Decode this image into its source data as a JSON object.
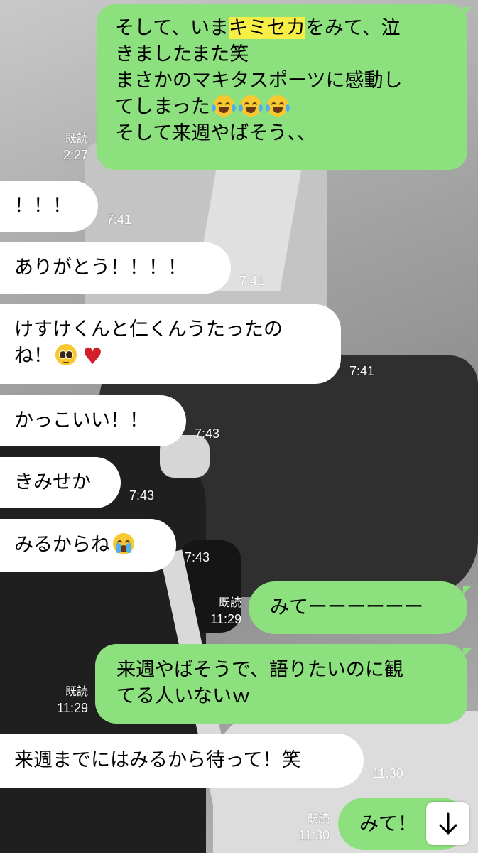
{
  "messages": [
    {
      "id": "m1",
      "direction": "sent",
      "lines": [
        {
          "before": "そして、いま",
          "highlight": "キミセカ",
          "after": "をみて、泣"
        },
        {
          "text": "きましたまた笑"
        },
        {
          "text": "まさかのマキタスポーツに感動し"
        },
        {
          "text": "てしまった"
        },
        {
          "text": "そして来週やばそう、、"
        }
      ],
      "emoji": [
        "tears-of-joy",
        "tears-of-joy",
        "tears-of-joy"
      ],
      "read": "既読",
      "time": "2:27"
    },
    {
      "id": "m2",
      "direction": "received",
      "text": "！！！",
      "time": "7:41"
    },
    {
      "id": "m3",
      "direction": "received",
      "text": "ありがとう！！！！",
      "time": "7:41"
    },
    {
      "id": "m4",
      "direction": "received",
      "lines": [
        {
          "text": "けすけくんと仁くんうたったの"
        },
        {
          "text": "ね！"
        }
      ],
      "emoji": [
        "pleading-face",
        "red-heart"
      ],
      "time": "7:41"
    },
    {
      "id": "m5",
      "direction": "received",
      "text": "かっこいい！！",
      "time": "7:43"
    },
    {
      "id": "m6",
      "direction": "received",
      "text": "きみせか",
      "time": "7:43"
    },
    {
      "id": "m7",
      "direction": "received",
      "text": "みるからね",
      "emoji": [
        "loudly-crying-face"
      ],
      "time": "7:43"
    },
    {
      "id": "m8",
      "direction": "sent",
      "text": "みてーーーーーー",
      "read": "既読",
      "time": "11:29"
    },
    {
      "id": "m9",
      "direction": "sent",
      "lines": [
        {
          "text": "来週やばそうで、語りたいのに観"
        },
        {
          "text": "てる人いないｗ"
        }
      ],
      "read": "既読",
      "time": "11:29"
    },
    {
      "id": "m10",
      "direction": "received",
      "text": "来週までにはみるから待って！笑",
      "time": "11:30"
    },
    {
      "id": "m11",
      "direction": "sent",
      "text": "みて！",
      "read": "既読",
      "time": "11:30"
    }
  ],
  "scroll_button": {
    "icon": "arrow-down-icon"
  },
  "colors": {
    "sent_bubble": "#8de07e",
    "received_bubble": "#ffffff",
    "highlight": "#f7ef46",
    "meta_text": "#ffffff",
    "background": "#8d8d8d"
  }
}
